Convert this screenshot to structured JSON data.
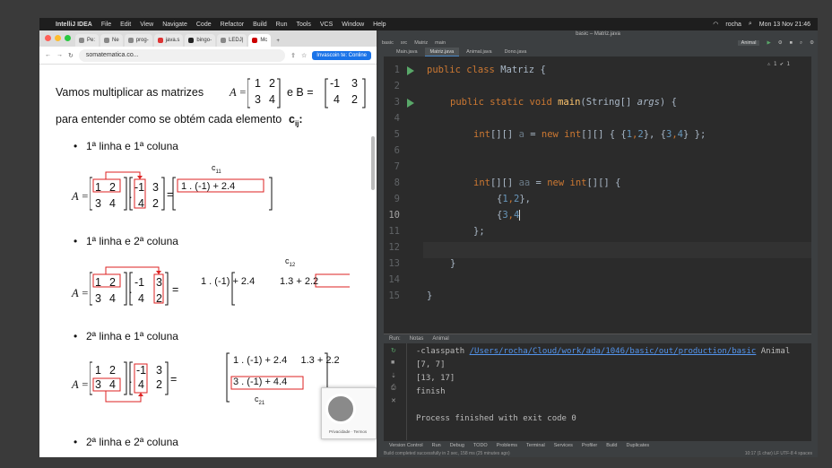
{
  "menubar": {
    "apple": "",
    "app": "IntelliJ IDEA",
    "menus": [
      "File",
      "Edit",
      "View",
      "Navigate",
      "Code",
      "Refactor",
      "Build",
      "Run",
      "Tools",
      "VCS",
      "Window",
      "Help"
    ],
    "user": "rocha",
    "clock": "Mon 13 Nov 21:46"
  },
  "browser": {
    "tabs": [
      "Pe:",
      "Ne",
      "prog-",
      "java.s",
      "bingo-",
      "LEDJ|",
      "Mc"
    ],
    "url": "somatematica.co...",
    "translate_label": "Invascoin te: Conline",
    "page": {
      "intro_a": "Vamos multiplicar as matrizes",
      "matA_label": "A =",
      "matA": [
        "1",
        "2",
        "3",
        "4"
      ],
      "and_b": "e B =",
      "matB": [
        "-1",
        "3",
        "4",
        "2"
      ],
      "intro_b": "para entender como se obtém cada elemento",
      "cij": "c",
      "cij_sub": "ij",
      "colon": ":",
      "bullets": [
        "1ª linha e 1ª coluna",
        "1ª linha e 2ª coluna",
        "2ª linha e 1ª coluna",
        "2ª linha e 2ª coluna"
      ],
      "c11": "c",
      "c11_sub": "11",
      "c12": "c",
      "c12_sub": "12",
      "c21": "c",
      "c21_sub": "21",
      "expr1": "1 . (-1) + 2.4",
      "expr2a": "1 . (-1) + 2.4",
      "expr2b": "1.3 +  2.2",
      "expr3a": "1 . (-1) + 2.4     1.3 + 2.2",
      "expr3b": "3 . (-1) + 4.4",
      "eq": "=",
      "dot": "."
    },
    "recaptcha_label": "Privacidade · Termos"
  },
  "ide": {
    "title": "basic – Matriz.java",
    "breadcrumb": [
      "basic",
      "src",
      "Matriz",
      "main"
    ],
    "run_config": "Animal",
    "tabs": [
      "Main.java",
      "Matriz.java",
      "Animal.java",
      "Dono.java"
    ],
    "active_tab": "Matriz.java",
    "warnings": "⚠ 1  ✔ 1",
    "line_numbers": [
      "1",
      "2",
      "3",
      "4",
      "5",
      "6",
      "7",
      "8",
      "9",
      "10",
      "11",
      "12",
      "13",
      "14",
      "15"
    ],
    "code": {
      "l1_kw": "public class ",
      "l1_name": "Matriz",
      "l1_rest": " {",
      "l3_kw": "public static void ",
      "l3_fn": "main",
      "l3_p1": "(String[] ",
      "l3_arg": "args",
      "l3_p2": ") {",
      "l5_a": "int",
      "l5_b": "[][] ",
      "l5_var": "a",
      "l5_c": " = ",
      "l5_new": "new ",
      "l5_int": "int",
      "l5_d": "[][] { {",
      "l5_n1": "1",
      "l5_e": ",",
      "l5_n2": "2",
      "l5_f": "}, {",
      "l5_n3": "3",
      "l5_g": ",",
      "l5_n4": "4",
      "l5_h": "} };",
      "l8_a": "int",
      "l8_b": "[][] ",
      "l8_var": "aa",
      "l8_c": " = ",
      "l8_new": "new ",
      "l8_int": "int",
      "l8_d": "[][] {",
      "l9_a": "{",
      "l9_n1": "1",
      "l9_b": ",",
      "l9_n2": "2",
      "l9_c": "},",
      "l10_a": "{",
      "l10_n1": "3",
      "l10_b": ",",
      "l10_n2": "4",
      "l11": "};",
      "l13": "}",
      "l15": "}"
    },
    "run_tabs": [
      "Run:",
      "Notas",
      "Animal"
    ],
    "console": {
      "line0a": "-classpath ",
      "line0_link": "/Users/rocha/Cloud/work/ada/1046/basic/out/production/basic",
      "line0b": " Animal",
      "line1": "[7, 7]",
      "line2": "[13, 17]",
      "line3": "finish",
      "line4": "",
      "line5": "Process finished with exit code 0"
    },
    "bottom_tools": [
      "Version Control",
      "Run",
      "Debug",
      "TODO",
      "Problems",
      "Terminal",
      "Services",
      "Profiler",
      "Build",
      "Duplicates"
    ],
    "status_left": "Build completed successfully in 2 sec, 158 ms (25 minutes ago)",
    "status_right": "10:17 (1 char)  LF  UTF-8  4 spaces"
  }
}
